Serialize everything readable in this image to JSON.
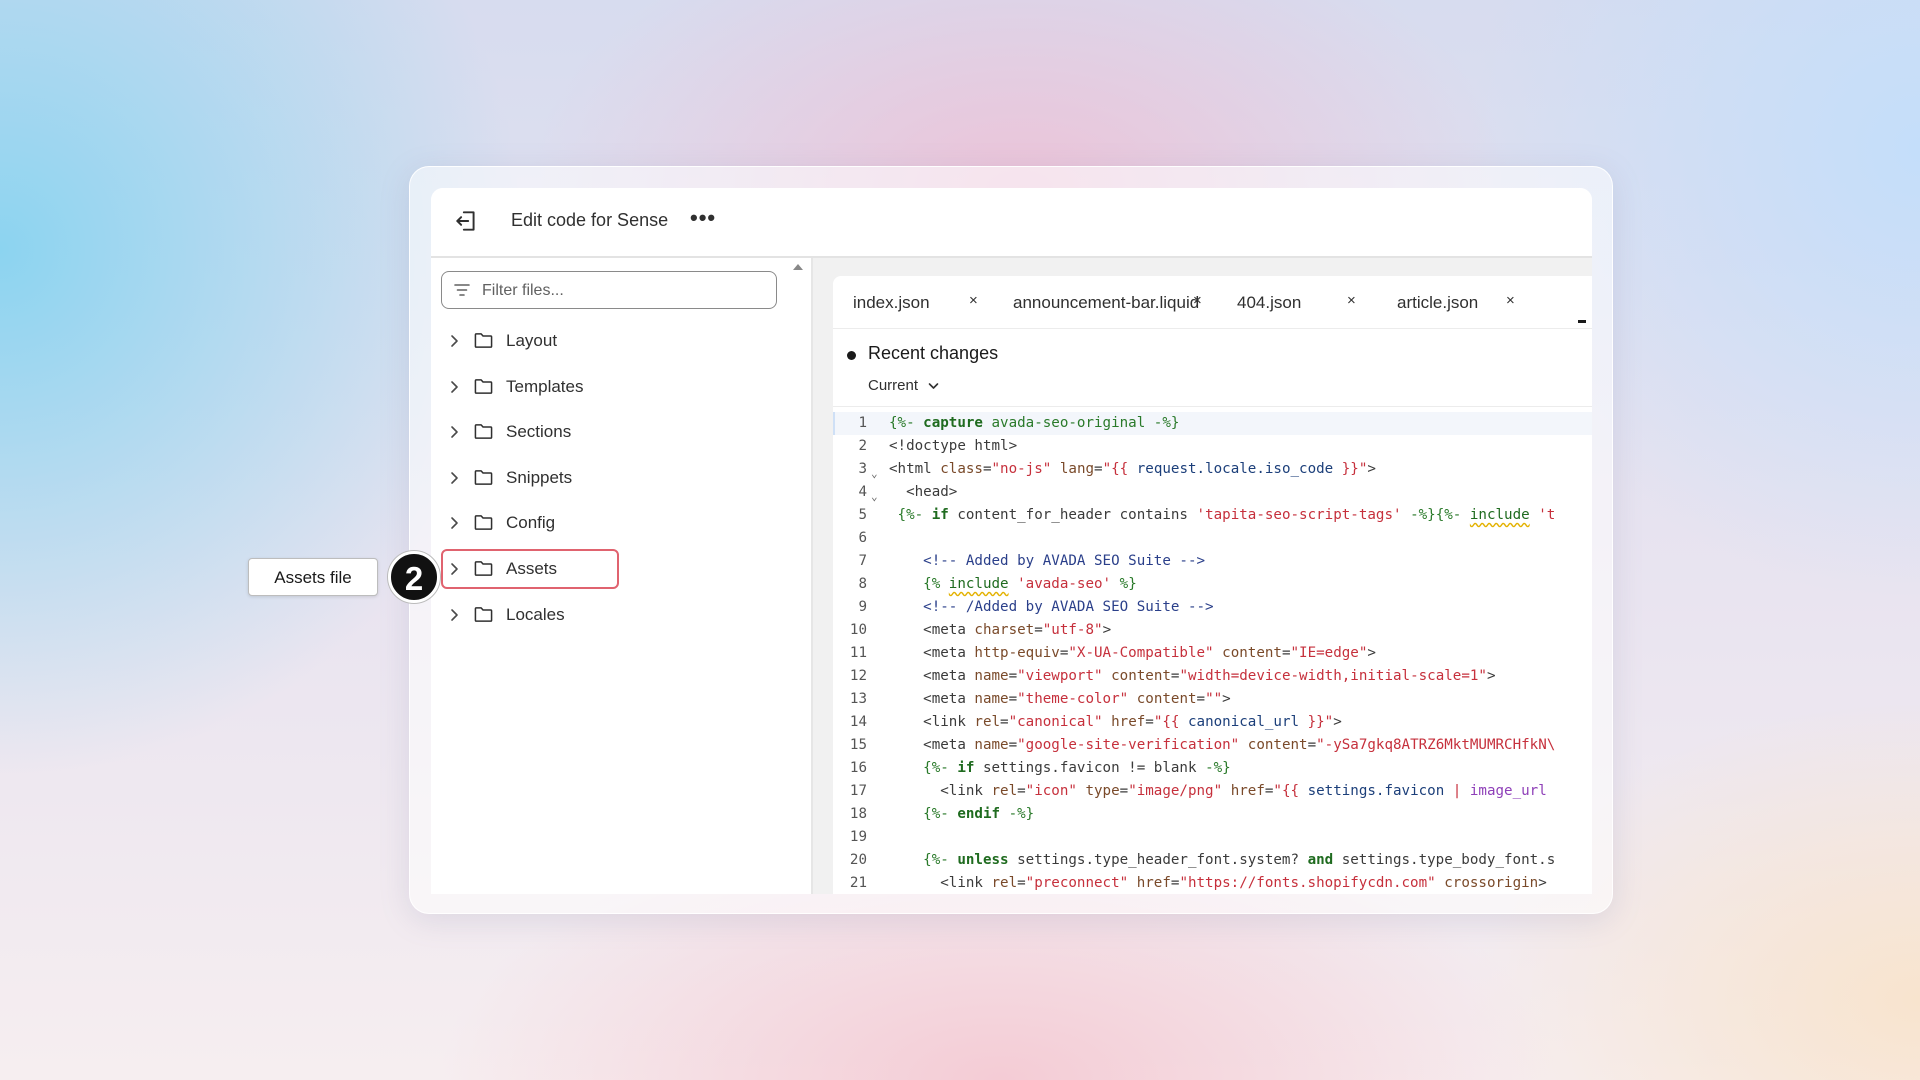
{
  "window": {
    "title": "Edit code for Sense",
    "more_label": "•••"
  },
  "sidebar": {
    "filter_placeholder": "Filter files...",
    "items": [
      {
        "label": "Layout"
      },
      {
        "label": "Templates"
      },
      {
        "label": "Sections"
      },
      {
        "label": "Snippets"
      },
      {
        "label": "Config"
      },
      {
        "label": "Assets"
      },
      {
        "label": "Locales"
      }
    ]
  },
  "tabs": [
    {
      "label": "index.json",
      "close": "×"
    },
    {
      "label": "announcement-bar.liquid",
      "close": "×"
    },
    {
      "label": "404.json",
      "close": "×"
    },
    {
      "label": "article.json",
      "close": "×"
    }
  ],
  "editor": {
    "recent_changes": "Recent changes",
    "version": "Current",
    "line_numbers": [
      "1",
      "2",
      "3",
      "4",
      "5",
      "6",
      "7",
      "8",
      "9",
      "10",
      "11",
      "12",
      "13",
      "14",
      "15",
      "16",
      "17",
      "18",
      "19",
      "20",
      "21"
    ]
  },
  "annotation": {
    "callout": "Assets file",
    "step": "2"
  },
  "colors": {
    "highlight": "#e0636f",
    "badge": "#111111"
  }
}
